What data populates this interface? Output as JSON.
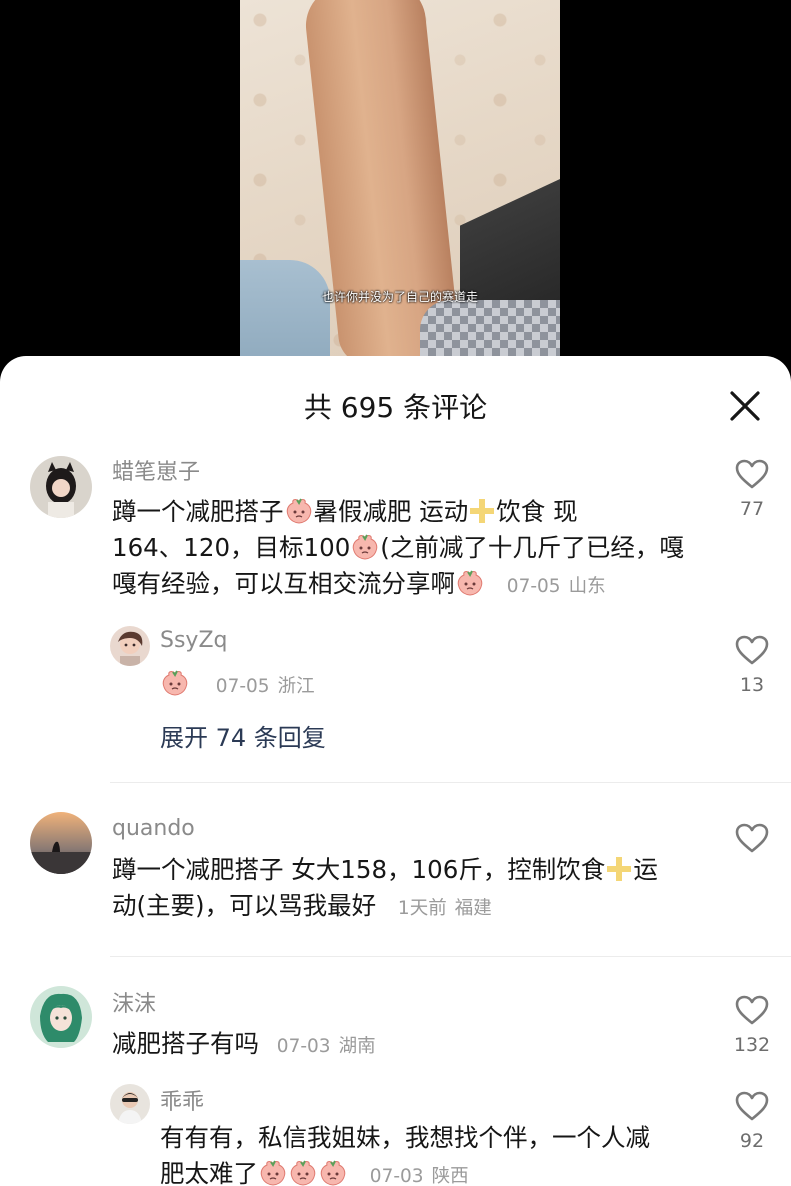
{
  "video": {
    "subtitle": "也许你并没为了自己的赛道走"
  },
  "panel": {
    "title": "共 695 条评论",
    "close_icon": "close-icon"
  },
  "comments": [
    {
      "username": "蜡笔崽子",
      "line1_a": "蹲一个减肥搭子",
      "line1_b": "暑假减肥  运动",
      "line1_c": "饮食  现",
      "line2_a": "164、120，目标100",
      "line2_b": "(之前减了十几斤了已经，嘎",
      "line3": "嘎有经验，可以互相交流分享啊",
      "date": "07-05",
      "location": "山东",
      "likes": "77",
      "replies": [
        {
          "username": "SsyZq",
          "date": "07-05",
          "location": "浙江",
          "likes": "13"
        }
      ],
      "expand_label": "展开 74 条回复"
    },
    {
      "username": "quando",
      "line1_a": "蹲一个减肥搭子  女大158，106斤，控制饮食",
      "line1_b": "运",
      "line2": "动(主要)，可以骂我最好",
      "date": "1天前",
      "location": "福建"
    },
    {
      "username": "沫沫",
      "line1": "减肥搭子有吗",
      "date": "07-03",
      "location": "湖南",
      "likes": "132",
      "replies": [
        {
          "username": "乖乖",
          "line1": "有有有，私信我姐妹，我想找个伴，一个人减",
          "line2": "肥太难了",
          "date": "07-03",
          "location": "陕西",
          "likes": "92"
        }
      ]
    }
  ],
  "colors": {
    "text": "#161616",
    "secondary": "#8a8a8a",
    "expand": "#2b3a55",
    "emoji": "#f2a7a0"
  },
  "icons": [
    "heart-outline-icon",
    "close-icon",
    "peach-cry-emoji",
    "plus-emoji"
  ]
}
